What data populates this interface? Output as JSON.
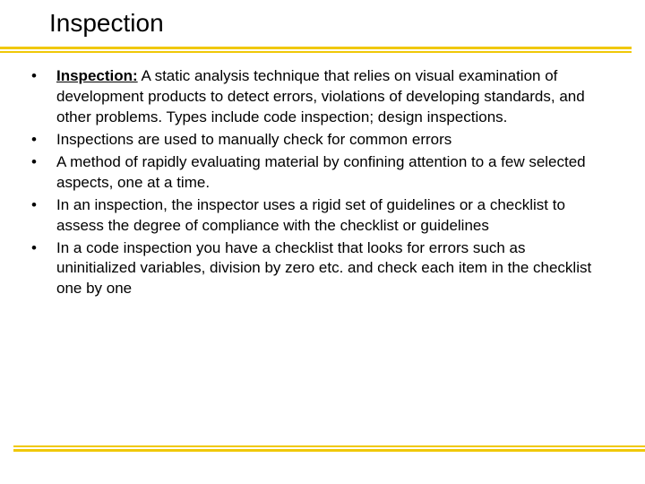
{
  "title": "Inspection",
  "bullets": [
    {
      "boldPrefix": "Inspection:",
      "text": " A static analysis technique that relies on visual examination of development products to detect errors, violations of developing standards, and other problems. Types include code inspection; design inspections."
    },
    {
      "boldPrefix": "",
      "text": "Inspections are used to manually check for common errors"
    },
    {
      "boldPrefix": "",
      "text": "A method of rapidly evaluating material by confining attention to a few selected aspects, one at a time."
    },
    {
      "boldPrefix": "",
      "text": "In an inspection, the inspector uses a rigid set of guidelines or a checklist to assess the degree of compliance with the checklist or guidelines"
    },
    {
      "boldPrefix": "",
      "text": "In a code inspection you have a checklist that looks for errors such as uninitialized variables, division by zero etc. and check each item in the checklist one by one"
    }
  ]
}
